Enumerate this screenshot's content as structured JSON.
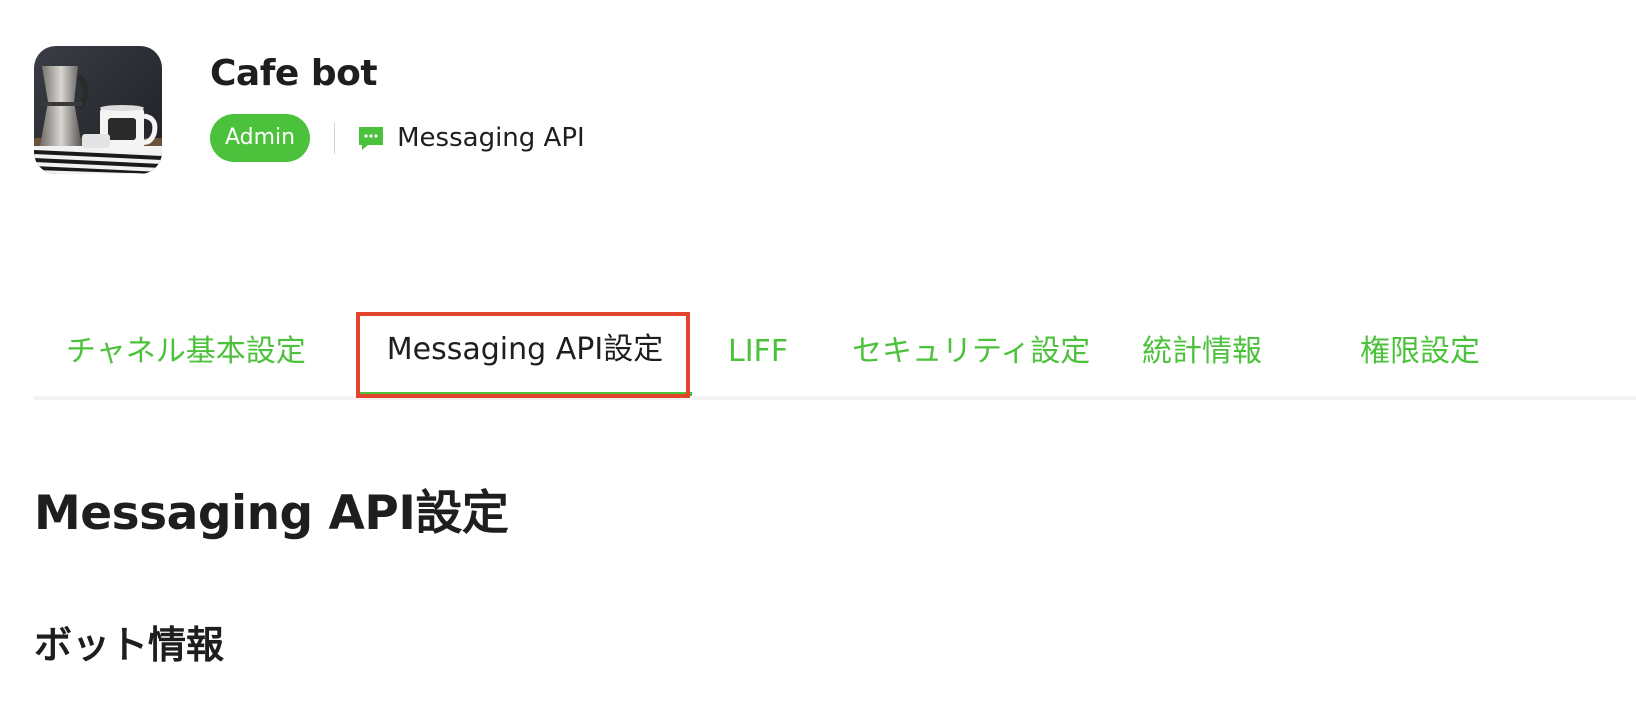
{
  "channel": {
    "name": "Cafe bot",
    "role_badge": "Admin",
    "type_label": "Messaging API"
  },
  "tabs": [
    {
      "label": "チャネル基本設定",
      "active": false
    },
    {
      "label": "Messaging API設定",
      "active": true
    },
    {
      "label": "LIFF",
      "active": false
    },
    {
      "label": "セキュリティ設定",
      "active": false
    },
    {
      "label": "統計情報",
      "active": false
    },
    {
      "label": "権限設定",
      "active": false
    }
  ],
  "main": {
    "page_title": "Messaging API設定",
    "section_title": "ボット情報"
  },
  "colors": {
    "accent_green": "#4cc13b",
    "highlight_red": "#e2442c",
    "text_dark": "#1e1e1e"
  },
  "icons": {
    "avatar": "coffee-cafe-photo",
    "channel_type": "chat-bubble-icon"
  }
}
